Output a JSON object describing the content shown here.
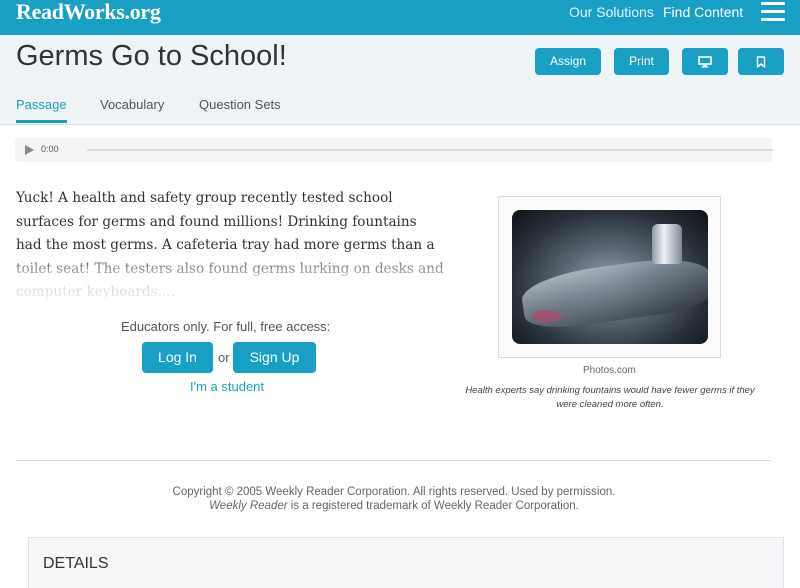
{
  "header": {
    "logo": "ReadWorks.org",
    "nav": [
      "Our Solutions",
      "Find Content"
    ],
    "menu_icon": "hamburger-icon"
  },
  "title_bar": {
    "title": "Germs Go to School!",
    "buttons": {
      "assign": "Assign",
      "print": "Print"
    },
    "icon_buttons": [
      "monitor-icon",
      "bookmark-icon"
    ],
    "tabs": [
      {
        "label": "Passage",
        "active": true
      },
      {
        "label": "Vocabulary",
        "active": false
      },
      {
        "label": "Question Sets",
        "active": false
      }
    ]
  },
  "audio": {
    "time": "0:00"
  },
  "passage": {
    "text": "Yuck! A health and safety group recently tested school surfaces for germs and found millions! Drinking fountains had the most germs. A cafeteria tray had more germs than a toilet seat! The testers also found germs lurking on desks and computer keyboards...."
  },
  "access": {
    "prompt": "Educators only. For full, free access:",
    "login": "Log In",
    "or": "or",
    "signup": "Sign Up",
    "student": "I'm a student"
  },
  "figure": {
    "credit": "Photos.com",
    "caption": "Health experts say drinking fountains would have fewer germs if they were cleaned more often."
  },
  "copyright": {
    "line1": "Copyright © 2005 Weekly Reader Corporation. All rights reserved. Used by permission.",
    "line2_em": "Weekly Reader",
    "line2_rest": " is a registered trademark of Weekly Reader Corporation."
  },
  "details": {
    "title": "DETAILS"
  },
  "colors": {
    "brand": "#1a9fc4",
    "header_bg": "#eef3f6"
  }
}
